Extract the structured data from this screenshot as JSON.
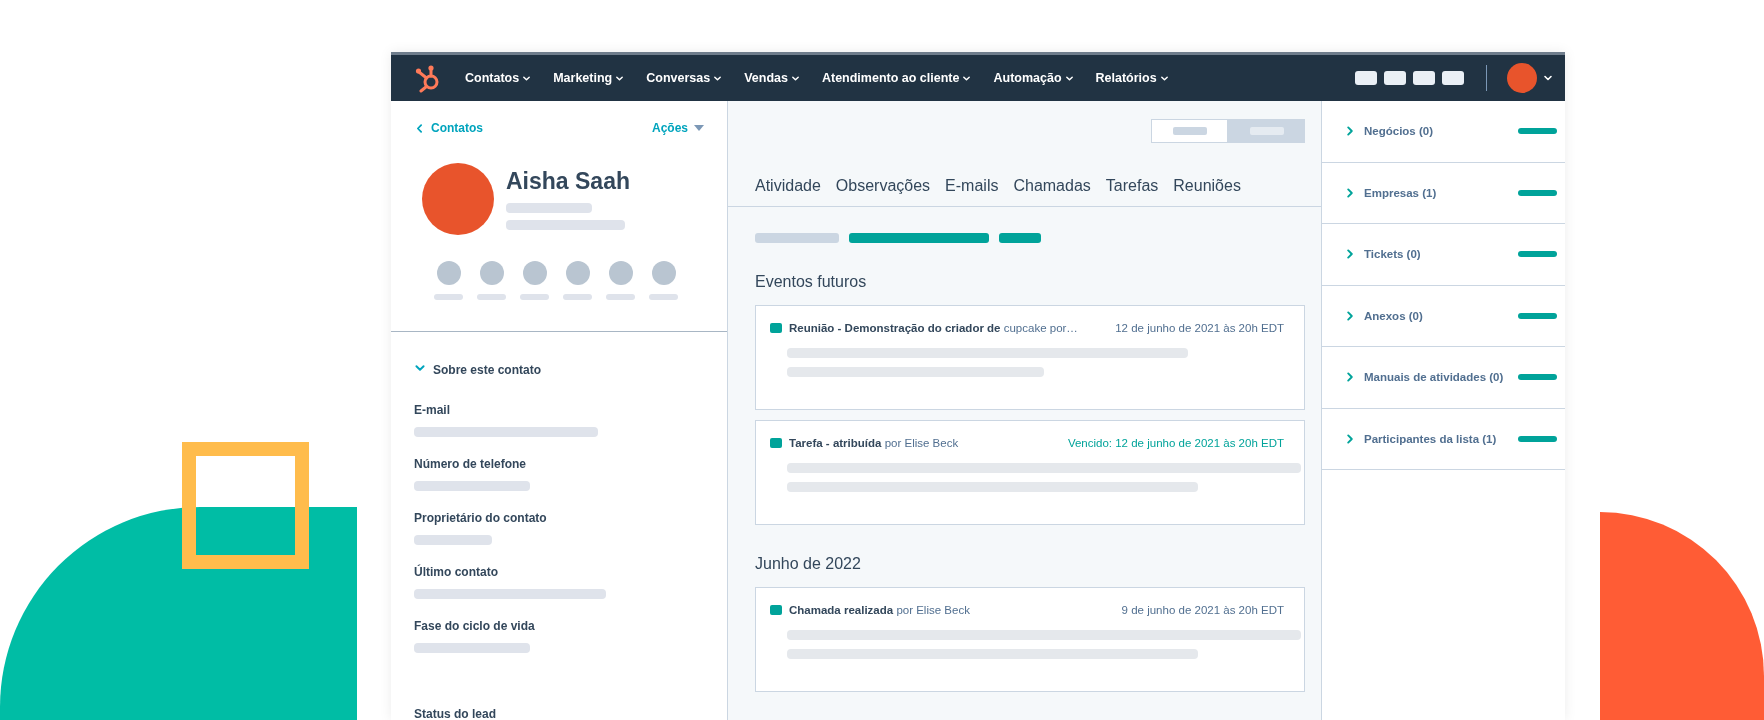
{
  "nav": {
    "items": [
      {
        "label": "Contatos"
      },
      {
        "label": "Marketing"
      },
      {
        "label": "Conversas"
      },
      {
        "label": "Vendas"
      },
      {
        "label": "Atendimento ao cliente"
      },
      {
        "label": "Automação"
      },
      {
        "label": "Relatórios"
      }
    ]
  },
  "contact": {
    "back": "Contatos",
    "actions": "Ações",
    "name": "Aisha Saah",
    "about": "Sobre este contato",
    "about_expanded": true,
    "fields": [
      "E-mail",
      "Número de telefone",
      "Proprietário do contato",
      "Último contato",
      "Fase do ciclo de vida",
      "Status do lead"
    ]
  },
  "timeline": {
    "tabs": [
      {
        "label": "Atividade",
        "selected": false
      },
      {
        "label": "Observações",
        "selected": false
      },
      {
        "label": "E-mails",
        "selected": false
      },
      {
        "label": "Chamadas",
        "selected": false
      },
      {
        "label": "Tarefas",
        "selected": false
      },
      {
        "label": "Reuniões",
        "selected": false
      }
    ],
    "sections": [
      {
        "title": "Eventos futuros",
        "events": [
          {
            "title": "**Reunião - Demonstração do criador de** cupcake por…",
            "date": "12 de junho de 2021 às 20h EDT",
            "overdue": false
          },
          {
            "title": "**Tarefa - atribuída** por Elise Beck",
            "date": "Vencido: 12 de junho de 2021 às 20h EDT",
            "overdue": true
          }
        ]
      },
      {
        "title": "Junho de 2022",
        "events": [
          {
            "title": "**Chamada realizada** por Elise Beck",
            "date": "9 de junho de 2021 às 20h EDT",
            "overdue": false
          }
        ]
      }
    ]
  },
  "associations": [
    {
      "label": "Negócios (0)"
    },
    {
      "label": "Empresas (1)"
    },
    {
      "label": "Tickets (0)"
    },
    {
      "label": "Anexos (0)"
    },
    {
      "label": "Manuais de atividades (0)"
    },
    {
      "label": "Participantes da lista (1)"
    }
  ]
}
